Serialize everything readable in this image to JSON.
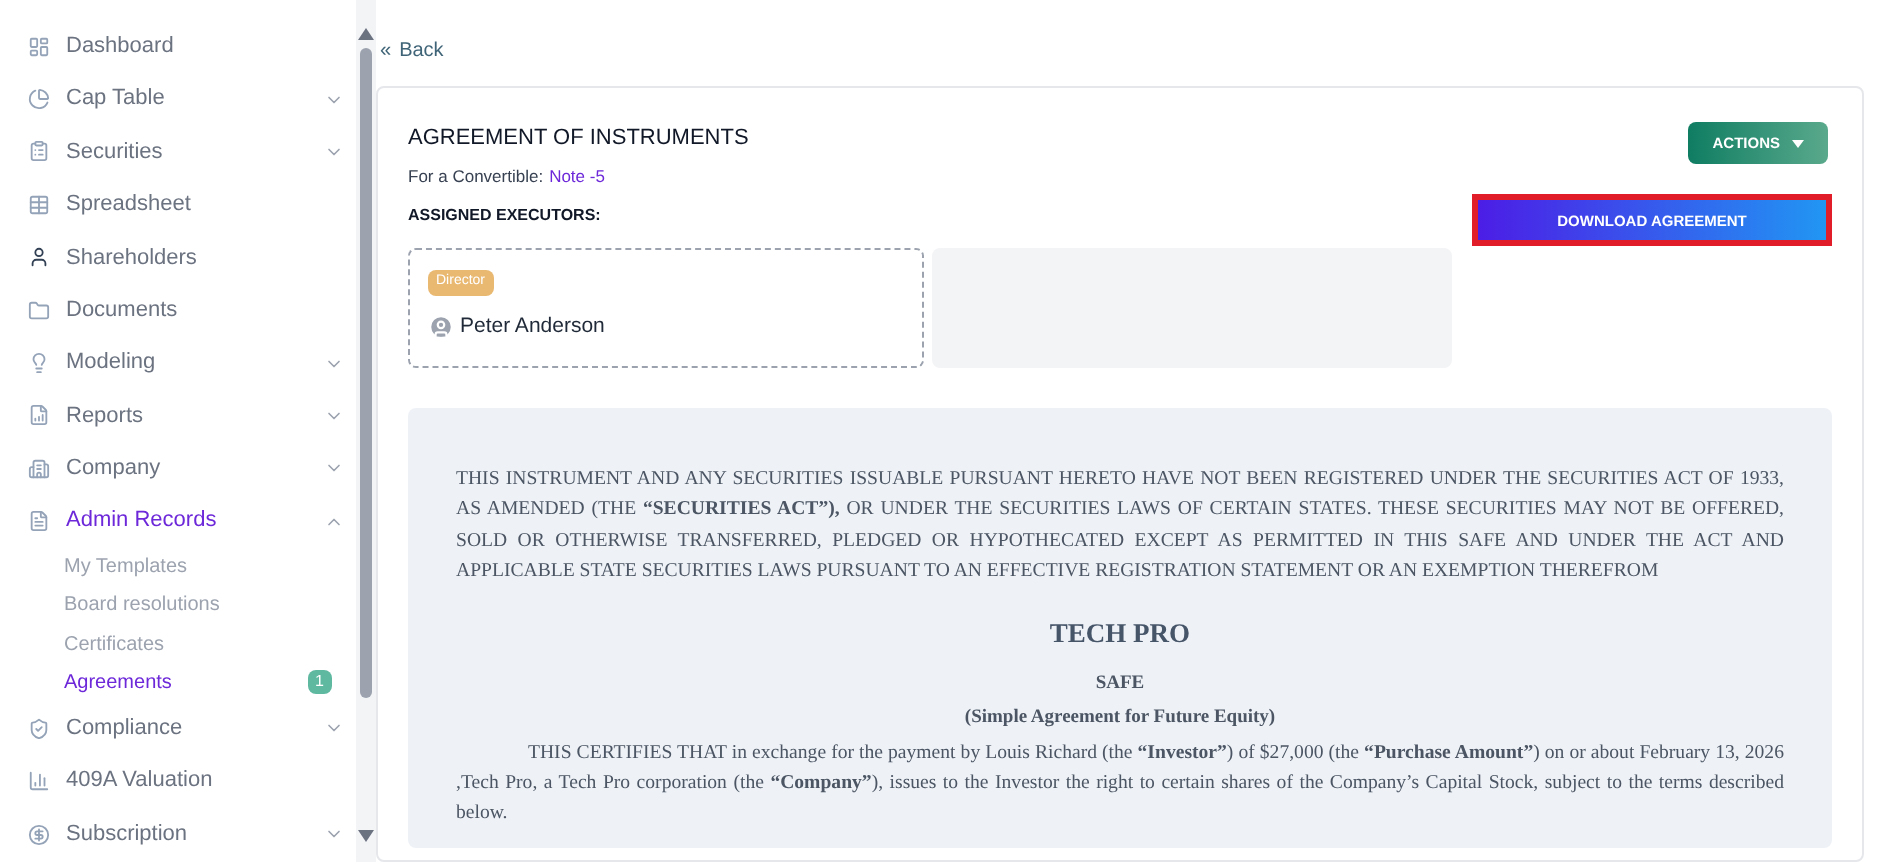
{
  "sidebar": {
    "items": [
      {
        "label": "Dashboard",
        "has_submenu": false,
        "selected": false
      },
      {
        "label": "Cap Table",
        "has_submenu": true,
        "expanded": false,
        "selected": false
      },
      {
        "label": "Securities",
        "has_submenu": true,
        "expanded": false,
        "selected": false
      },
      {
        "label": "Spreadsheet",
        "has_submenu": false,
        "selected": false
      },
      {
        "label": "Shareholders",
        "has_submenu": false,
        "selected": false
      },
      {
        "label": "Documents",
        "has_submenu": false,
        "selected": false
      },
      {
        "label": "Modeling",
        "has_submenu": true,
        "expanded": false,
        "selected": false
      },
      {
        "label": "Reports",
        "has_submenu": true,
        "expanded": false,
        "selected": false
      },
      {
        "label": "Company",
        "has_submenu": true,
        "expanded": false,
        "selected": false
      },
      {
        "label": "Admin Records",
        "has_submenu": true,
        "expanded": true,
        "selected": true,
        "children": [
          {
            "label": "My Templates",
            "selected": false
          },
          {
            "label": "Board resolutions",
            "selected": false
          },
          {
            "label": "Certificates",
            "selected": false
          },
          {
            "label": "Agreements",
            "selected": true,
            "badge": "1"
          }
        ]
      },
      {
        "label": "Compliance",
        "has_submenu": true,
        "expanded": false,
        "selected": false
      },
      {
        "label": "409A Valuation",
        "has_submenu": false,
        "selected": false
      },
      {
        "label": "Subscription",
        "has_submenu": true,
        "expanded": false,
        "selected": false
      }
    ]
  },
  "back": {
    "icon": "«",
    "label": "Back"
  },
  "header": {
    "title": "AGREEMENT OF INSTRUMENTS",
    "subtitle_label": "For a Convertible:",
    "subtitle_link": "Note -5",
    "actions_button": "ACTIONS",
    "download_button": "DOWNLOAD AGREEMENT",
    "download_highlighted": true
  },
  "executors": {
    "title": "ASSIGNED EXECUTORS:",
    "items": [
      {
        "role": "Director",
        "name": "Peter Anderson"
      }
    ]
  },
  "document": {
    "legend": "THIS INSTRUMENT AND ANY SECURITIES ISSUABLE PURSUANT HERETO HAVE NOT BEEN REGISTERED UNDER THE SECURITIES ACT OF 1933, AS AMENDED (THE **“SECURITIES ACT”),** OR UNDER THE SECURITIES LAWS OF CERTAIN STATES. THESE SECURITIES MAY NOT BE OFFERED, SOLD OR OTHERWISE TRANSFERRED, PLEDGED OR HYPOTHECATED EXCEPT AS PERMITTED IN THIS SAFE AND UNDER THE ACT AND APPLICABLE STATE SECURITIES LAWS PURSUANT TO AN EFFECTIVE REGISTRATION STATEMENT OR AN EXEMPTION THEREFROM",
    "company": "TECH PRO",
    "doc_type": "SAFE",
    "doc_subtitle": "(Simple Agreement for Future Equity)",
    "body": "THIS CERTIFIES THAT in exchange for the payment by Louis Richard (the **“Investor”**) of $27,000 (the **“Purchase Amount”**) on or about February 13, 2026 ,Tech Pro, a Tech Pro corporation (the **“Company”**), issues to the Investor the right to certain shares of the Company’s Capital Stock, subject to the terms described below."
  }
}
